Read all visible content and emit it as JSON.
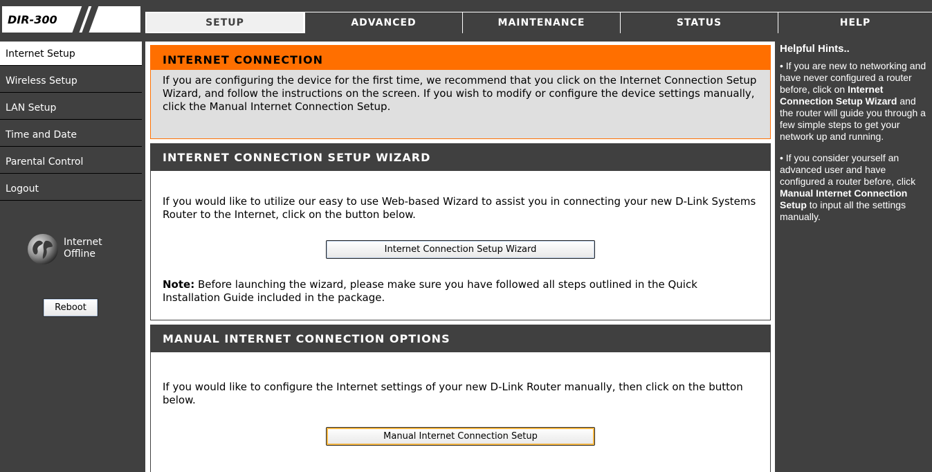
{
  "header": {
    "model": "DIR-300",
    "tabs": [
      {
        "label": "SETUP",
        "active": true
      },
      {
        "label": "ADVANCED"
      },
      {
        "label": "MAINTENANCE"
      },
      {
        "label": "STATUS"
      },
      {
        "label": "HELP"
      }
    ]
  },
  "sidebar": {
    "items": [
      {
        "label": "Internet Setup",
        "active": true
      },
      {
        "label": "Wireless Setup"
      },
      {
        "label": "LAN Setup"
      },
      {
        "label": "Time and Date"
      },
      {
        "label": "Parental Control"
      },
      {
        "label": "Logout"
      }
    ],
    "status_line1": "Internet",
    "status_line2": "Offline",
    "reboot_label": "Reboot"
  },
  "main": {
    "intro": {
      "title": "INTERNET CONNECTION",
      "text": "If you are configuring the device for the first time, we recommend that you click on the Internet Connection Setup Wizard, and follow the instructions on the screen. If you wish to modify or configure the device settings manually, click the Manual Internet Connection Setup."
    },
    "wizard": {
      "title": "INTERNET CONNECTION SETUP WIZARD",
      "text": "If you would like to utilize our easy to use Web-based Wizard to assist you in connecting your new D-Link Systems Router to the Internet, click on the button below.",
      "button_label": "Internet Connection Setup Wizard",
      "note_label": "Note:",
      "note_text": " Before launching the wizard, please make sure you have followed all steps outlined in the Quick Installation Guide included in the package."
    },
    "manual": {
      "title": "MANUAL INTERNET CONNECTION OPTIONS",
      "text": "If you would like to configure the Internet settings of your new D-Link Router manually, then click on the button below.",
      "button_label": "Manual Internet Connection Setup"
    }
  },
  "hints": {
    "title": "Helpful Hints..",
    "hint1_a": "• If you are new to networking and have never configured a router before, click on ",
    "hint1_b": "Internet Connection Setup Wizard",
    "hint1_c": " and the router will guide you through a few simple steps to get your network up and running.",
    "hint2_a": "• If you consider yourself an advanced user and have configured a router before, click ",
    "hint2_b": "Manual Internet Connection Setup",
    "hint2_c": " to input all the settings manually."
  },
  "colors": {
    "accent": "#ff6f00",
    "dark": "#404040",
    "intro_bg": "#dfdfdf"
  }
}
